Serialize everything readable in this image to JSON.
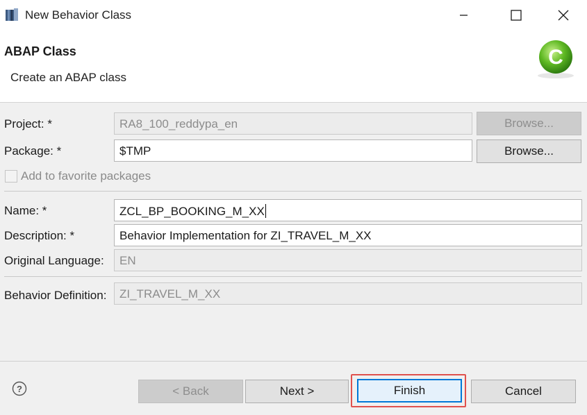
{
  "window": {
    "title": "New Behavior Class",
    "controls": [
      "minimize-icon",
      "maximize-icon",
      "close-icon"
    ]
  },
  "header": {
    "title": "ABAP Class",
    "description": "Create an ABAP class",
    "logo_letter": "C"
  },
  "form": {
    "project": {
      "label": "Project: *",
      "value": "RA8_100_reddypa_en",
      "browse_label": "Browse...",
      "enabled": false
    },
    "package": {
      "label": "Package: *",
      "value": "$TMP",
      "browse_label": "Browse...",
      "enabled": true
    },
    "favorite_checkbox": {
      "label": "Add to favorite packages",
      "checked": false,
      "enabled": false
    },
    "name": {
      "label": "Name: *",
      "value": "ZCL_BP_BOOKING_M_XX"
    },
    "description": {
      "label": "Description: *",
      "value": "Behavior Implementation for ZI_TRAVEL_M_XX"
    },
    "original_language": {
      "label": "Original Language:",
      "value": "EN"
    },
    "behavior_definition": {
      "label": "Behavior Definition:",
      "value": "ZI_TRAVEL_M_XX"
    }
  },
  "footer": {
    "back_label": "< Back",
    "next_label": "Next >",
    "finish_label": "Finish",
    "cancel_label": "Cancel"
  },
  "colors": {
    "highlight": "#e0514d",
    "focus": "#0078d7",
    "logo_green": "#5fb923"
  }
}
